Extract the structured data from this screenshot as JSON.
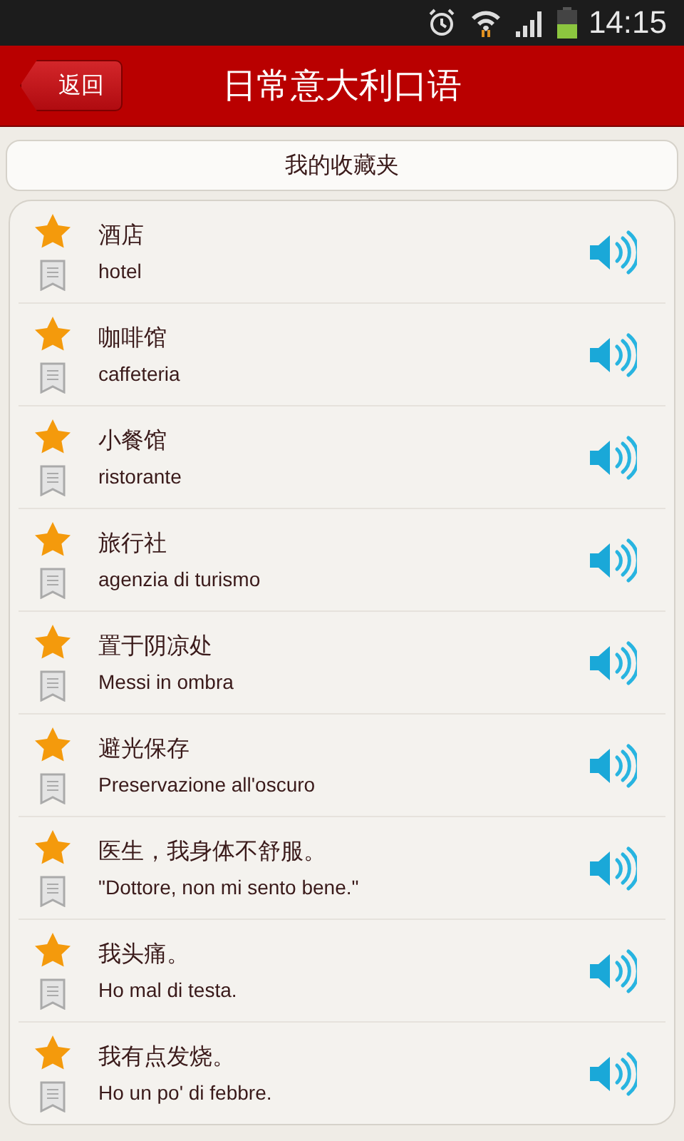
{
  "status_bar": {
    "time": "14:15"
  },
  "header": {
    "back": "返回",
    "title": "日常意大利口语"
  },
  "section": {
    "title": "我的收藏夹"
  },
  "phrases": [
    {
      "chinese": "酒店",
      "italian": "hotel",
      "starred": true
    },
    {
      "chinese": "咖啡馆",
      "italian": "caffeteria",
      "starred": true
    },
    {
      "chinese": "小餐馆",
      "italian": "ristorante",
      "starred": true
    },
    {
      "chinese": "旅行社",
      "italian": "agenzia di turismo",
      "starred": true
    },
    {
      "chinese": "置于阴凉处",
      "italian": "Messi in ombra",
      "starred": true
    },
    {
      "chinese": "避光保存",
      "italian": "Preservazione all'oscuro",
      "starred": true
    },
    {
      "chinese": "医生，我身体不舒服。",
      "italian": "\"Dottore, non mi sento bene.\"",
      "starred": true
    },
    {
      "chinese": "我头痛。",
      "italian": "Ho mal di testa.",
      "starred": true
    },
    {
      "chinese": "我有点发烧。",
      "italian": "Ho un po' di febbre.",
      "starred": true
    }
  ]
}
